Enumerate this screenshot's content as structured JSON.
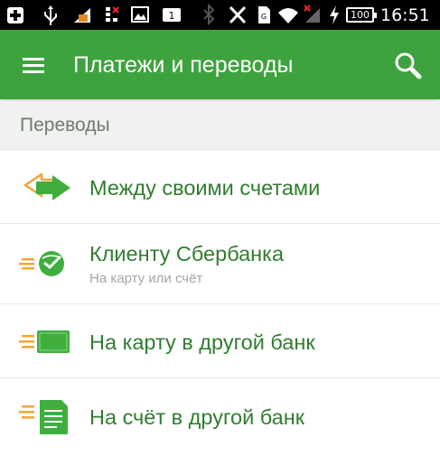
{
  "statusbar": {
    "battery": "100",
    "time": "16:51",
    "icons": [
      "plus-icon",
      "usb-icon",
      "debug-icon",
      "signal-icon",
      "image-icon",
      "notification-count-icon",
      "bluetooth-icon",
      "vibrate-off-icon",
      "sim-icon",
      "wifi-icon",
      "no-signal-icon",
      "charging-icon",
      "battery-icon"
    ],
    "notification_count": "1"
  },
  "appbar": {
    "title": "Платежи и переводы",
    "menu_icon": "hamburger-menu-icon",
    "search_icon": "search-icon"
  },
  "section": {
    "title": "Переводы"
  },
  "items": [
    {
      "title": "Между своими счетами",
      "subtitle": "",
      "icon": "transfer-arrows-icon"
    },
    {
      "title": "Клиенту Сбербанка",
      "subtitle": "На карту или счёт",
      "icon": "sberbank-logo-icon"
    },
    {
      "title": "На карту в другой банк",
      "subtitle": "",
      "icon": "bank-card-icon"
    },
    {
      "title": "На счёт в другой банк",
      "subtitle": "",
      "icon": "account-document-icon"
    }
  ],
  "colors": {
    "appbar": "#3ea33e",
    "item_text": "#2f7d2f",
    "icon_green": "#3fae3f",
    "icon_orange": "#f3a530"
  }
}
